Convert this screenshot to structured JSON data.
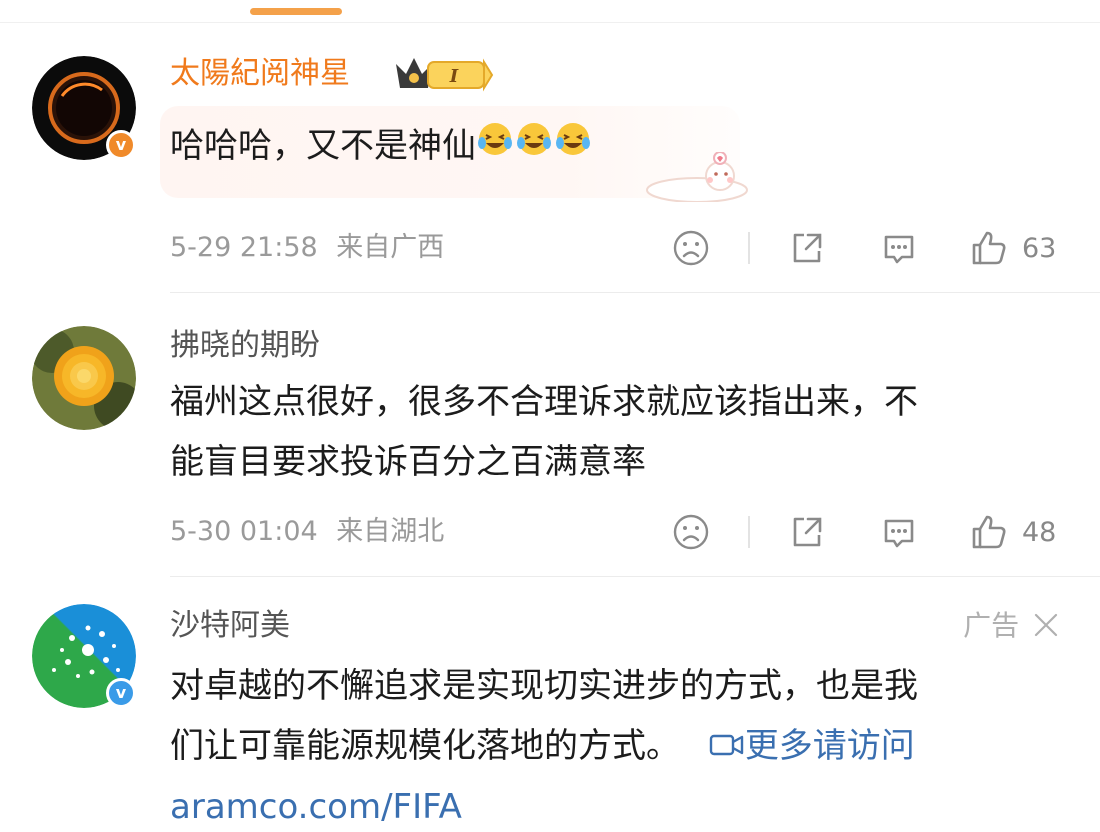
{
  "comments": [
    {
      "username": "太陽紀阅神星",
      "text": "哈哈哈，又不是神仙",
      "emoji_count": 3,
      "time": "5-29 21:58",
      "location": "来自广西",
      "likes": "63",
      "verified": "orange",
      "member_badge": "I"
    },
    {
      "username": "拂晓的期盼",
      "text_line1": "福州这点很好，很多不合理诉求就应该指出来，不",
      "text_line2": "能盲目要求投诉百分之百满意率",
      "time": "5-30 01:04",
      "location": "来自湖北",
      "likes": "48"
    },
    {
      "username": "沙特阿美",
      "ad_label": "广告",
      "text_line1": "对卓越的不懈追求是实现切实进步的方式，也是我",
      "text_line2": "们让可靠能源规模化落地的方式。",
      "link_label": "更多请访问",
      "url": "aramco.com/FIFA",
      "verified": "blue"
    }
  ],
  "colors": {
    "accent": "#f4a14a",
    "vip_name": "#f07a1c",
    "link": "#3a6fb0",
    "meta": "#9a9a9a"
  },
  "icons": {
    "sad": "sad-face-icon",
    "share": "share-icon",
    "comment": "comment-icon",
    "like": "thumbs-up-icon",
    "close": "close-icon",
    "video": "video-icon",
    "verified": "verified-v-icon"
  }
}
